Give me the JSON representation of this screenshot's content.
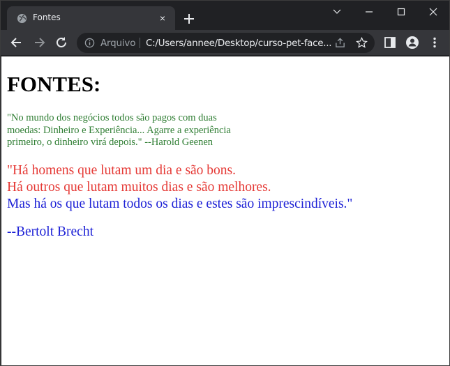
{
  "browser": {
    "tab": {
      "title": "Fontes",
      "close_glyph": "×"
    },
    "address": {
      "site_label": "Arquivo",
      "url": "C:/Users/annee/Desktop/curso-pet-face..."
    },
    "icons": {
      "favicon": "globe-icon",
      "back": "arrow-left-icon",
      "forward": "arrow-right-icon",
      "reload": "reload-icon",
      "info": "info-icon",
      "share": "share-icon",
      "bookmark": "star-icon",
      "side_panel": "side-panel-icon",
      "profile": "profile-icon",
      "menu": "kebab-menu-icon"
    },
    "colors": {
      "frame": "#202124",
      "toolbar": "#35363a",
      "text": "#e8eaed"
    }
  },
  "page": {
    "heading": "FONTES:",
    "quote1": "\"No mundo dos negócios todos são pagos com duas moedas: Dinheiro e Experiência... Agarre a experiência primeiro, o dinheiro virá depois.\" --Harold Geenen",
    "quote2_line1": "\"Há homens que lutam um dia e são bons.",
    "quote2_line2": "Há outros que lutam muitos dias e são melhores.",
    "quote2_line3": "Mas há os que lutam todos os dias e estes são imprescindíveis.\"",
    "author": "--Bertolt Brecht",
    "colors": {
      "green": "#2e7d32",
      "red": "#e53935",
      "blue": "#1e22d6"
    }
  }
}
